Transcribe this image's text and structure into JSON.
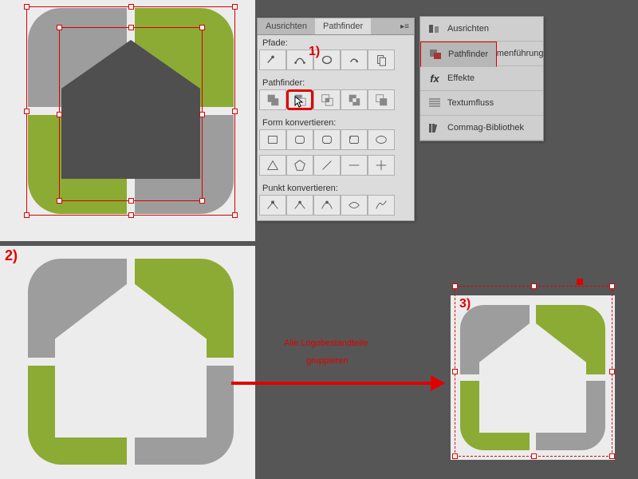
{
  "colors": {
    "green": "#8bab35",
    "gray": "#9d9d9d",
    "dark": "#4f4f4f",
    "red": "#e10000"
  },
  "panel": {
    "tab_inactive": "Ausrichten",
    "tab_active": "Pathfinder",
    "section_paths": "Pfade:",
    "section_pathfinder": "Pathfinder:",
    "section_convert_shape": "Form konvertieren:",
    "section_convert_point": "Punkt konvertieren:"
  },
  "dock": [
    {
      "label": "Ausrichten"
    },
    {
      "label": "Pathfinder"
    },
    {
      "label": "Datenzusammenführung"
    },
    {
      "label": "Effekte"
    },
    {
      "label": "Textumfluss"
    },
    {
      "label": "Commag-Bibliothek"
    }
  ],
  "markers": {
    "one": "1)",
    "two": "2)",
    "three": "3)"
  },
  "annotation": {
    "line1": "Alle Logobestandteile",
    "line2": "gruppieren"
  }
}
